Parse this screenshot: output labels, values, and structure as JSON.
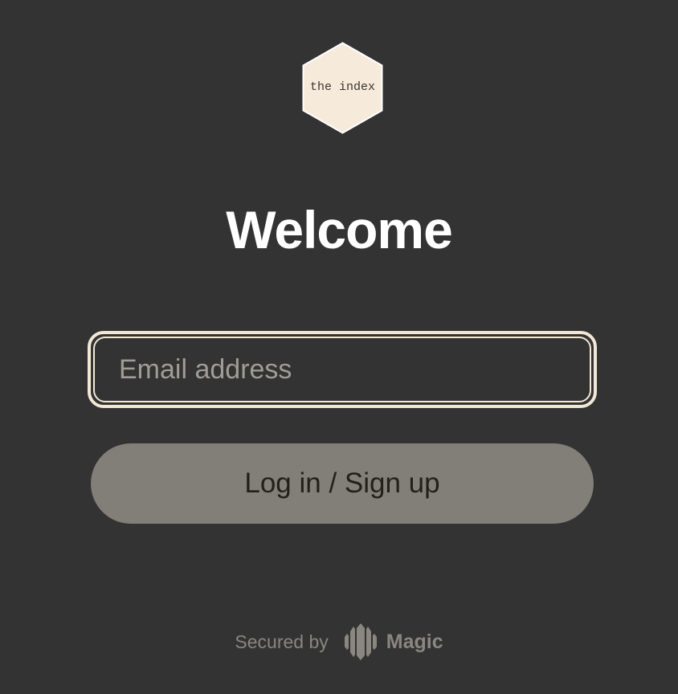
{
  "logo": {
    "text": "the index",
    "fill_color": "#f6eadb",
    "stroke_color": "#ffffff"
  },
  "page": {
    "title": "Welcome"
  },
  "email": {
    "placeholder": "Email address",
    "value": ""
  },
  "login_button": {
    "label": "Log in / Sign up"
  },
  "footer": {
    "secured_label": "Secured by",
    "brand_name": "Magic",
    "brand_icon": "magic-logo-icon"
  },
  "colors": {
    "background": "#333333",
    "accent": "#f3e8d6",
    "button_bg": "#827f79",
    "button_text": "#231f1b",
    "muted_text": "#8a8680"
  }
}
